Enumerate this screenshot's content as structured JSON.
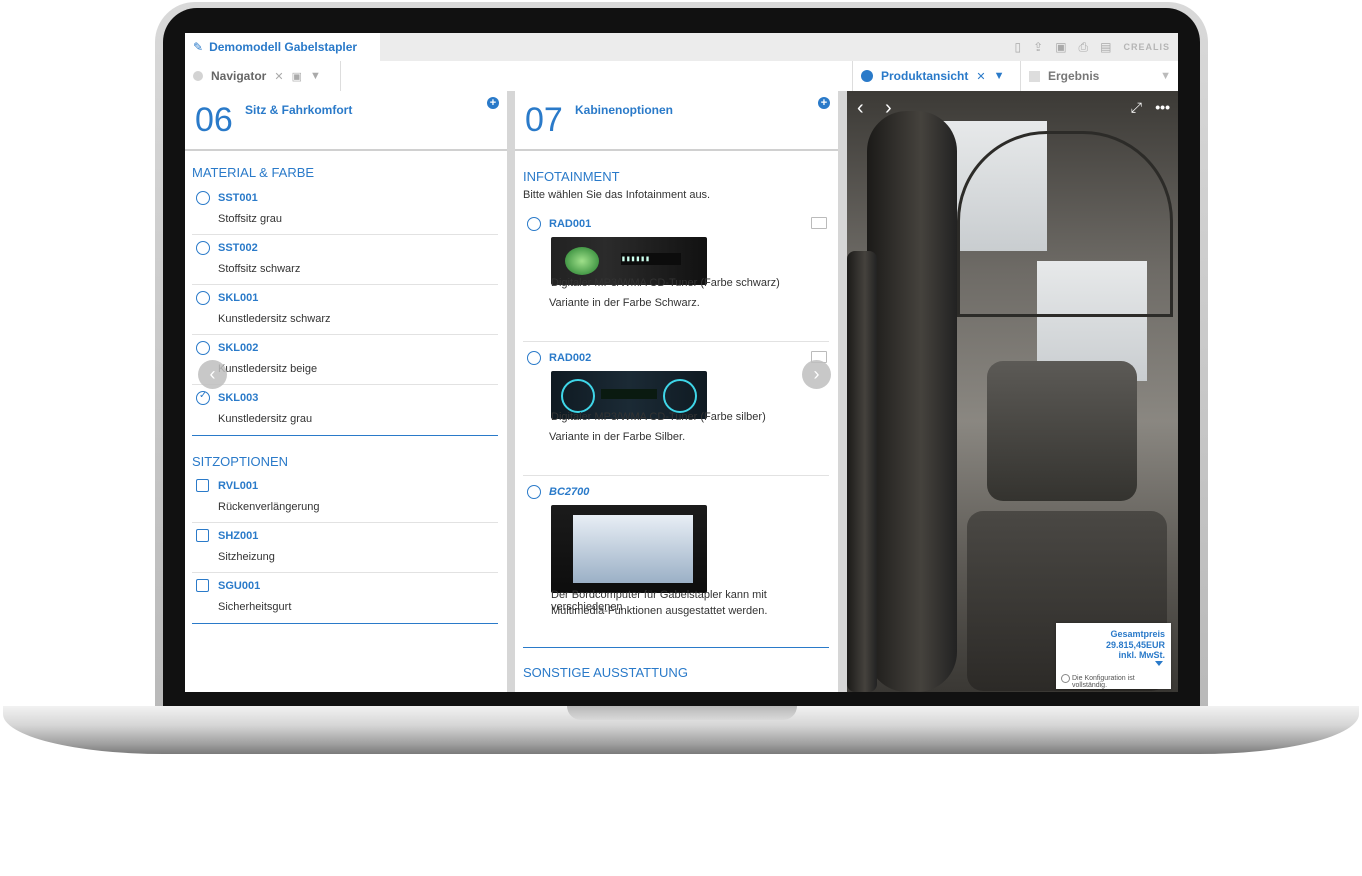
{
  "app": {
    "doc_title": "Demomodell Gabelstapler",
    "brand": "CREALIS",
    "toolbar_icons": [
      "new-document-icon",
      "open-icon",
      "save-icon",
      "print-icon",
      "pdf-icon"
    ]
  },
  "panels": {
    "navigator": "Navigator",
    "product_view": "Produktansicht",
    "result": "Ergebnis"
  },
  "col1": {
    "num": "06",
    "title": "Sitz & Fahrkomfort",
    "section1": "MATERIAL & FARBE",
    "material_options": [
      {
        "code": "SST001",
        "desc": "Stoffsitz grau",
        "selected": false
      },
      {
        "code": "SST002",
        "desc": "Stoffsitz schwarz",
        "selected": false
      },
      {
        "code": "SKL001",
        "desc": "Kunstledersitz schwarz",
        "selected": false
      },
      {
        "code": "SKL002",
        "desc": "Kunstledersitz beige",
        "selected": false
      },
      {
        "code": "SKL003",
        "desc": "Kunstledersitz grau",
        "selected": true
      }
    ],
    "section2": "SITZOPTIONEN",
    "seat_options": [
      {
        "code": "RVL001",
        "desc": "Rückenverlängerung"
      },
      {
        "code": "SHZ001",
        "desc": "Sitzheizung"
      },
      {
        "code": "SGU001",
        "desc": "Sicherheitsgurt"
      }
    ]
  },
  "col2": {
    "num": "07",
    "title": "Kabinenoptionen",
    "section1": "INFOTAINMENT",
    "section1_sub": "Bitte wählen Sie das Infotainment aus.",
    "items": [
      {
        "code": "RAD001",
        "line1": "Digitaler MP3/WMA CD-Tuner (Farbe schwarz)",
        "line2": "Variante in der Farbe Schwarz."
      },
      {
        "code": "RAD002",
        "line1": "Digitaler MP3/WMA CD-Tuner (Farbe silber)",
        "line2": "Variante in der Farbe Silber."
      },
      {
        "code": "BC2700",
        "line1": "Der Bordcomputer für Gabelstapler kann mit verschiedenen",
        "line2": "Multimedia-Funktionen ausgestattet werden."
      }
    ],
    "section2": "SONSTIGE AUSSTATTUNG"
  },
  "price": {
    "label": "Gesamtpreis",
    "value": "29.815,45EUR",
    "tax": "inkl. MwSt.",
    "status": "Die Konfiguration ist vollständig."
  },
  "colors": {
    "accent": "#2a7ac9"
  }
}
